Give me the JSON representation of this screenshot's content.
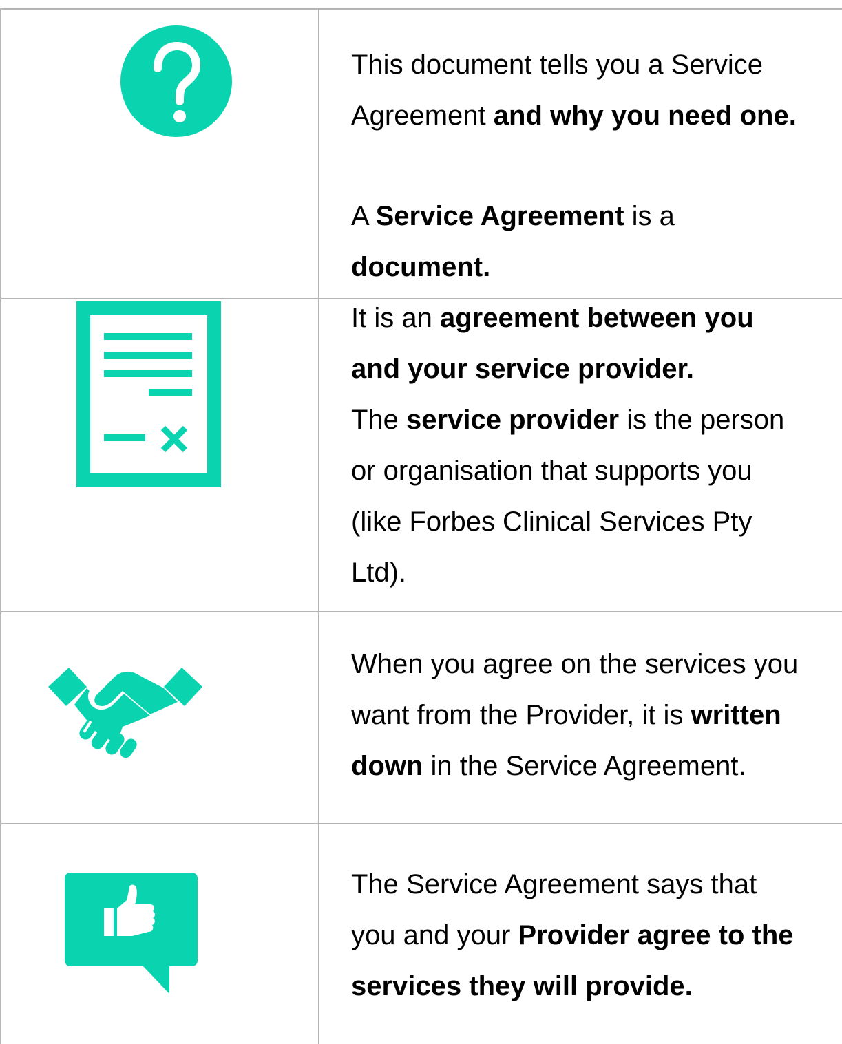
{
  "accent_color": "#0ad4b0",
  "rows": [
    {
      "icon": "question-mark-icon",
      "lines": [
        [
          {
            "t": "This document tells you a Service",
            "b": false
          }
        ],
        [
          {
            "t": "Agreement ",
            "b": false
          },
          {
            "t": "and why you need one.",
            "b": true
          }
        ]
      ]
    },
    {
      "icon": "document-icon",
      "lines": [
        [
          {
            "t": "A ",
            "b": false
          },
          {
            "t": "Service Agreement",
            "b": true
          },
          {
            "t": " is a",
            "b": false
          }
        ],
        [
          {
            "t": "document.",
            "b": true
          }
        ],
        [
          {
            "t": "It is an ",
            "b": false
          },
          {
            "t": "agreement between you",
            "b": true
          }
        ],
        [
          {
            "t": "and your service provider.",
            "b": true
          }
        ],
        [
          {
            "t": "The ",
            "b": false
          },
          {
            "t": "service provider",
            "b": true
          },
          {
            "t": " is the person",
            "b": false
          }
        ],
        [
          {
            "t": "or organisation that supports you",
            "b": false
          }
        ],
        [
          {
            "t": "(like Forbes Clinical Services Pty",
            "b": false
          }
        ],
        [
          {
            "t": "Ltd).",
            "b": false
          }
        ]
      ]
    },
    {
      "icon": "handshake-icon",
      "lines": [
        [
          {
            "t": "When you agree on the services you",
            "b": false
          }
        ],
        [
          {
            "t": "want from the Provider, it is ",
            "b": false
          },
          {
            "t": "written",
            "b": true
          }
        ],
        [
          {
            "t": "down",
            "b": true
          },
          {
            "t": " in the Service Agreement.",
            "b": false
          }
        ]
      ]
    },
    {
      "icon": "thumbs-up-speech-bubble-icon",
      "lines": [
        [
          {
            "t": "The Service Agreement says that",
            "b": false
          }
        ],
        [
          {
            "t": "you and your ",
            "b": false
          },
          {
            "t": "Provider agree to the",
            "b": true
          }
        ],
        [
          {
            "t": "services they will provide.",
            "b": true
          }
        ]
      ]
    }
  ]
}
